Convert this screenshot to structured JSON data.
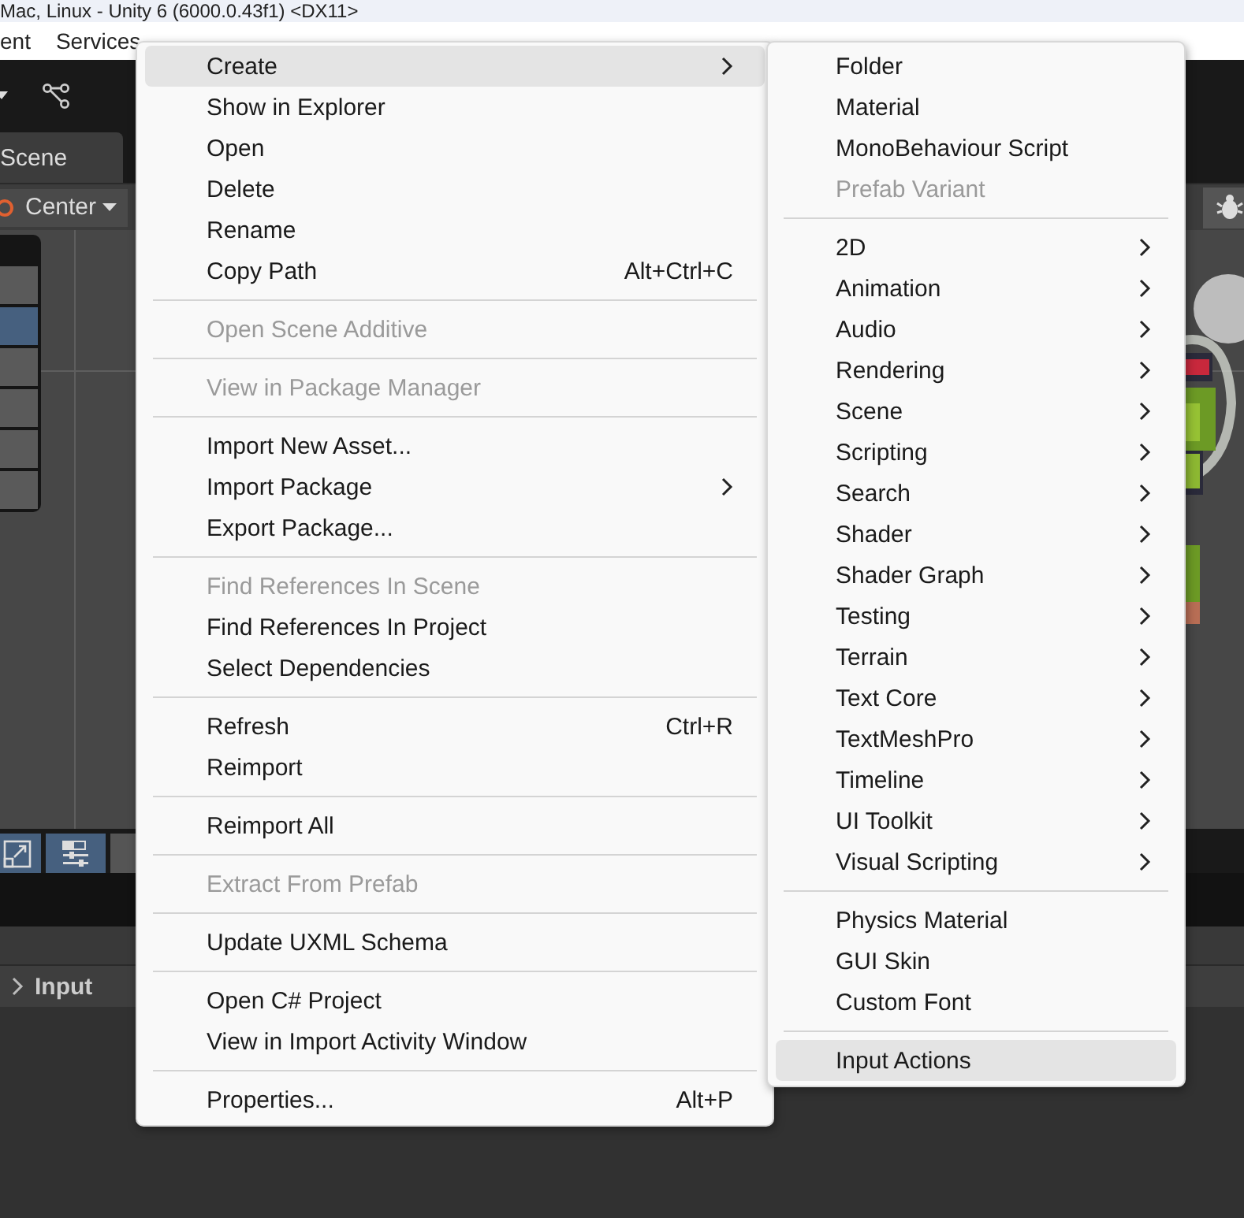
{
  "window": {
    "title": "Mac, Linux - Unity 6 (6000.0.43f1) <DX11>"
  },
  "menu_bar": [
    "ent",
    "Services"
  ],
  "scene_tab": {
    "label": "Scene"
  },
  "scene_toolbar": {
    "pivot": "Center"
  },
  "tools": [
    {
      "selected": false
    },
    {
      "selected": true
    },
    {
      "selected": false
    },
    {
      "selected": false
    },
    {
      "selected": false
    },
    {
      "selected": false
    }
  ],
  "bottom_panel": {
    "foldout": "Input"
  },
  "context_menu": {
    "items": [
      {
        "kind": "item",
        "label": "Create",
        "submenu": true,
        "disabled": false,
        "selected": true
      },
      {
        "kind": "item",
        "label": "Show in Explorer",
        "submenu": false,
        "disabled": false,
        "selected": false
      },
      {
        "kind": "item",
        "label": "Open",
        "submenu": false,
        "disabled": false,
        "selected": false
      },
      {
        "kind": "item",
        "label": "Delete",
        "submenu": false,
        "disabled": false,
        "selected": false
      },
      {
        "kind": "item",
        "label": "Rename",
        "submenu": false,
        "disabled": false,
        "selected": false
      },
      {
        "kind": "item",
        "label": "Copy Path",
        "shortcut": "Alt+Ctrl+C",
        "submenu": false,
        "disabled": false,
        "selected": false
      },
      {
        "kind": "separator"
      },
      {
        "kind": "item",
        "label": "Open Scene Additive",
        "submenu": false,
        "disabled": true,
        "selected": false
      },
      {
        "kind": "separator"
      },
      {
        "kind": "item",
        "label": "View in Package Manager",
        "submenu": false,
        "disabled": true,
        "selected": false
      },
      {
        "kind": "separator"
      },
      {
        "kind": "item",
        "label": "Import New Asset...",
        "submenu": false,
        "disabled": false,
        "selected": false
      },
      {
        "kind": "item",
        "label": "Import Package",
        "submenu": true,
        "disabled": false,
        "selected": false
      },
      {
        "kind": "item",
        "label": "Export Package...",
        "submenu": false,
        "disabled": false,
        "selected": false
      },
      {
        "kind": "separator"
      },
      {
        "kind": "item",
        "label": "Find References In Scene",
        "submenu": false,
        "disabled": true,
        "selected": false
      },
      {
        "kind": "item",
        "label": "Find References In Project",
        "submenu": false,
        "disabled": false,
        "selected": false
      },
      {
        "kind": "item",
        "label": "Select Dependencies",
        "submenu": false,
        "disabled": false,
        "selected": false
      },
      {
        "kind": "separator"
      },
      {
        "kind": "item",
        "label": "Refresh",
        "shortcut": "Ctrl+R",
        "submenu": false,
        "disabled": false,
        "selected": false
      },
      {
        "kind": "item",
        "label": "Reimport",
        "submenu": false,
        "disabled": false,
        "selected": false
      },
      {
        "kind": "separator"
      },
      {
        "kind": "item",
        "label": "Reimport All",
        "submenu": false,
        "disabled": false,
        "selected": false
      },
      {
        "kind": "separator"
      },
      {
        "kind": "item",
        "label": "Extract From Prefab",
        "submenu": false,
        "disabled": true,
        "selected": false
      },
      {
        "kind": "separator"
      },
      {
        "kind": "item",
        "label": "Update UXML Schema",
        "submenu": false,
        "disabled": false,
        "selected": false
      },
      {
        "kind": "separator"
      },
      {
        "kind": "item",
        "label": "Open C# Project",
        "submenu": false,
        "disabled": false,
        "selected": false
      },
      {
        "kind": "item",
        "label": "View in Import Activity Window",
        "submenu": false,
        "disabled": false,
        "selected": false
      },
      {
        "kind": "separator"
      },
      {
        "kind": "item",
        "label": "Properties...",
        "shortcut": "Alt+P",
        "submenu": false,
        "disabled": false,
        "selected": false
      }
    ]
  },
  "submenu": {
    "items": [
      {
        "kind": "item",
        "label": "Folder",
        "submenu": false,
        "disabled": false,
        "selected": false
      },
      {
        "kind": "item",
        "label": "Material",
        "submenu": false,
        "disabled": false,
        "selected": false
      },
      {
        "kind": "item",
        "label": "MonoBehaviour Script",
        "submenu": false,
        "disabled": false,
        "selected": false
      },
      {
        "kind": "item",
        "label": "Prefab Variant",
        "submenu": false,
        "disabled": true,
        "selected": false
      },
      {
        "kind": "separator"
      },
      {
        "kind": "item",
        "label": "2D",
        "submenu": true,
        "disabled": false,
        "selected": false
      },
      {
        "kind": "item",
        "label": "Animation",
        "submenu": true,
        "disabled": false,
        "selected": false
      },
      {
        "kind": "item",
        "label": "Audio",
        "submenu": true,
        "disabled": false,
        "selected": false
      },
      {
        "kind": "item",
        "label": "Rendering",
        "submenu": true,
        "disabled": false,
        "selected": false
      },
      {
        "kind": "item",
        "label": "Scene",
        "submenu": true,
        "disabled": false,
        "selected": false
      },
      {
        "kind": "item",
        "label": "Scripting",
        "submenu": true,
        "disabled": false,
        "selected": false
      },
      {
        "kind": "item",
        "label": "Search",
        "submenu": true,
        "disabled": false,
        "selected": false
      },
      {
        "kind": "item",
        "label": "Shader",
        "submenu": true,
        "disabled": false,
        "selected": false
      },
      {
        "kind": "item",
        "label": "Shader Graph",
        "submenu": true,
        "disabled": false,
        "selected": false
      },
      {
        "kind": "item",
        "label": "Testing",
        "submenu": true,
        "disabled": false,
        "selected": false
      },
      {
        "kind": "item",
        "label": "Terrain",
        "submenu": true,
        "disabled": false,
        "selected": false
      },
      {
        "kind": "item",
        "label": "Text Core",
        "submenu": true,
        "disabled": false,
        "selected": false
      },
      {
        "kind": "item",
        "label": "TextMeshPro",
        "submenu": true,
        "disabled": false,
        "selected": false
      },
      {
        "kind": "item",
        "label": "Timeline",
        "submenu": true,
        "disabled": false,
        "selected": false
      },
      {
        "kind": "item",
        "label": "UI Toolkit",
        "submenu": true,
        "disabled": false,
        "selected": false
      },
      {
        "kind": "item",
        "label": "Visual Scripting",
        "submenu": true,
        "disabled": false,
        "selected": false
      },
      {
        "kind": "separator"
      },
      {
        "kind": "item",
        "label": "Physics Material",
        "submenu": false,
        "disabled": false,
        "selected": false
      },
      {
        "kind": "item",
        "label": "GUI Skin",
        "submenu": false,
        "disabled": false,
        "selected": false
      },
      {
        "kind": "item",
        "label": "Custom Font",
        "submenu": false,
        "disabled": false,
        "selected": false
      },
      {
        "kind": "separator"
      },
      {
        "kind": "item",
        "label": "Input Actions",
        "submenu": false,
        "disabled": false,
        "selected": true
      }
    ]
  }
}
